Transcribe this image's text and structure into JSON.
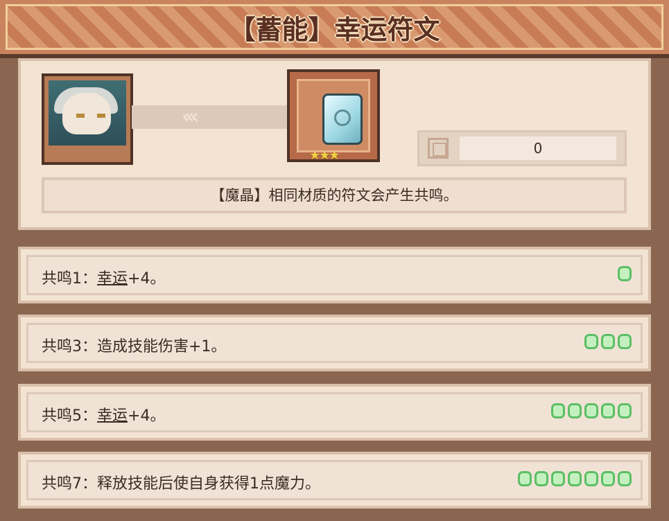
{
  "banner": {
    "title": "【蓄能】幸运符文"
  },
  "rune": {
    "stars": "★★★",
    "count": "0"
  },
  "description": "【魔晶】相同材质的符文会产生共鸣。",
  "resonances": [
    {
      "label_prefix": "共鸣1：",
      "keyword": "幸运",
      "label_suffix": "+4。",
      "dots": 1
    },
    {
      "label_prefix": "共鸣3：",
      "keyword": "",
      "label_suffix": "造成技能伤害+1。",
      "dots": 3
    },
    {
      "label_prefix": "共鸣5：",
      "keyword": "幸运",
      "label_suffix": "+4。",
      "dots": 5
    },
    {
      "label_prefix": "共鸣7：",
      "keyword": "",
      "label_suffix": "释放技能后使自身获得1点魔力。",
      "dots": 7
    }
  ],
  "colors": {
    "accent_green": "#5bbf64",
    "banner": "#c9845f",
    "panel": "#f3e3d3"
  },
  "icons": {
    "arrows": "‹‹‹"
  }
}
